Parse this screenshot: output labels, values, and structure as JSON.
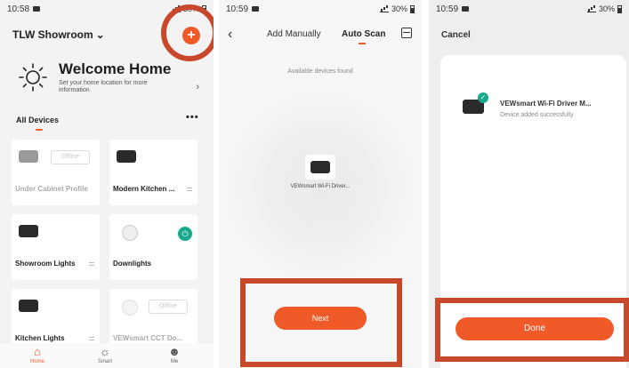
{
  "screen1": {
    "time": "10:58",
    "battery": "30%",
    "home_name": "TLW Showroom",
    "welcome_title": "Welcome Home",
    "welcome_sub": "Set your home location for more information",
    "section_title": "All Devices",
    "more": "•••",
    "offline_label": "Offline",
    "devices": [
      {
        "name": "Under Cabinet Profile"
      },
      {
        "name": "Modern Kitchen ..."
      },
      {
        "name": "Showroom Lights"
      },
      {
        "name": "Downlights"
      },
      {
        "name": "Kitchen Lights"
      },
      {
        "name": "VEWsmart CCT Do..."
      }
    ],
    "tabs": [
      {
        "label": "Home"
      },
      {
        "label": "Smart"
      },
      {
        "label": "Me"
      }
    ]
  },
  "screen2": {
    "time": "10:59",
    "battery": "30%",
    "tab_manual": "Add Manually",
    "tab_auto": "Auto Scan",
    "found_label": "Available devices found",
    "device_name": "VEWsmart Wi-Fi Driver...",
    "next_label": "Next"
  },
  "screen3": {
    "time": "10:59",
    "battery": "30%",
    "cancel_label": "Cancel",
    "device_name": "VEWsmart Wi-Fi Driver M...",
    "status": "Device added successfully",
    "done_label": "Done"
  },
  "colors": {
    "accent": "#ef5a28",
    "highlight": "#c8482c",
    "success": "#18a88a"
  }
}
